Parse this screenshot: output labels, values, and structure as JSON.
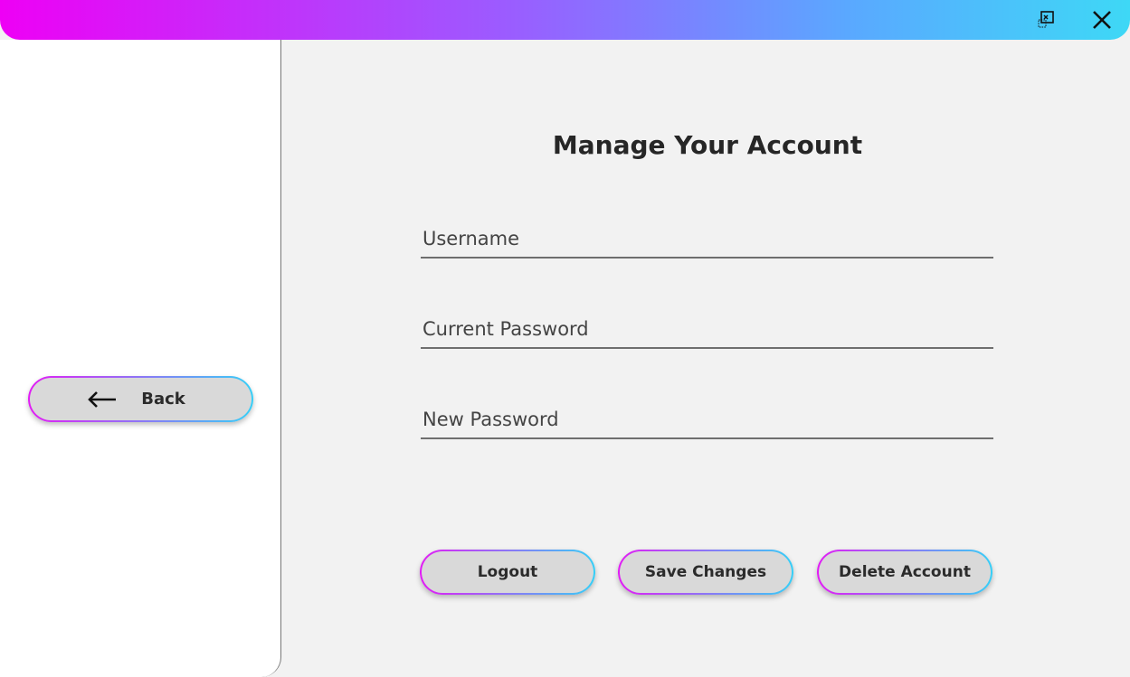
{
  "window": {
    "restore_icon": "restore-window-icon",
    "close_icon": "close-icon",
    "gradient_colors": [
      "#ee00f5",
      "#9b5cff",
      "#5aa8ff",
      "#3ed8f6"
    ]
  },
  "sidebar": {
    "back_label": "Back",
    "back_icon": "left-arrow-icon"
  },
  "main": {
    "title": "Manage Your Account",
    "fields": {
      "username_placeholder": "Username",
      "current_password_placeholder": "Current Password",
      "new_password_placeholder": "New Password"
    },
    "buttons": {
      "logout": "Logout",
      "save_changes": "Save Changes",
      "delete_account": "Delete Account"
    }
  },
  "colors": {
    "button_fill": "#d9d9d9",
    "border_gradient_start": "#e21cf5",
    "border_gradient_end": "#36cff7",
    "background": "#f2f2f2"
  }
}
